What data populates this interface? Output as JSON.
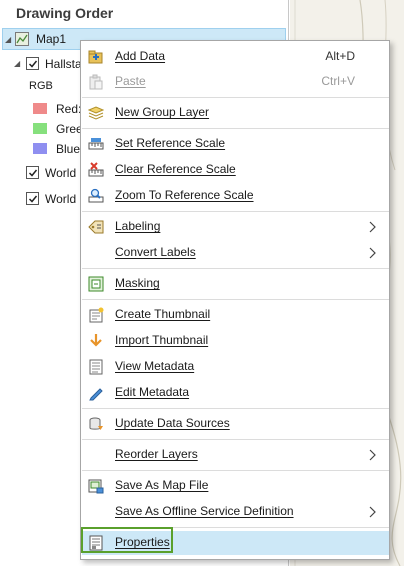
{
  "panel": {
    "title": "Drawing Order",
    "map_label": "Map1",
    "layer_label": "Hallsta",
    "rgb_label": "RGB",
    "bands": [
      {
        "label": "Red:",
        "color": "#ef8a8a"
      },
      {
        "label": "Gree",
        "color": "#86e07d"
      },
      {
        "label": "Blue",
        "color": "#8f8ff0"
      }
    ],
    "world1_label": "World",
    "world2_label": "World"
  },
  "menu": {
    "items": [
      {
        "key": "add-data",
        "label": "Add Data",
        "shortcut": "Alt+D",
        "icon": "add-data-icon"
      },
      {
        "key": "paste",
        "label": "Paste",
        "shortcut": "Ctrl+V",
        "icon": "paste-icon",
        "disabled": true
      },
      {
        "key": "new-group-layer",
        "label": "New Group Layer",
        "icon": "group-layer-icon"
      },
      {
        "key": "set-reference-scale",
        "label": "Set Reference Scale",
        "icon": "set-scale-icon"
      },
      {
        "key": "clear-reference-scale",
        "label": "Clear Reference Scale",
        "icon": "clear-scale-icon"
      },
      {
        "key": "zoom-to-reference-scale",
        "label": "Zoom To Reference Scale",
        "icon": "zoom-scale-icon"
      },
      {
        "key": "labeling",
        "label": "Labeling",
        "icon": "labeling-icon",
        "submenu": true
      },
      {
        "key": "convert-labels",
        "label": "Convert Labels",
        "submenu": true
      },
      {
        "key": "masking",
        "label": "Masking",
        "icon": "masking-icon"
      },
      {
        "key": "create-thumbnail",
        "label": "Create Thumbnail",
        "icon": "create-thumbnail-icon"
      },
      {
        "key": "import-thumbnail",
        "label": "Import Thumbnail",
        "icon": "import-thumbnail-icon"
      },
      {
        "key": "view-metadata",
        "label": "View Metadata",
        "icon": "view-metadata-icon"
      },
      {
        "key": "edit-metadata",
        "label": "Edit Metadata",
        "icon": "edit-metadata-icon"
      },
      {
        "key": "update-data-sources",
        "label": "Update Data Sources",
        "icon": "update-sources-icon"
      },
      {
        "key": "reorder-layers",
        "label": "Reorder Layers",
        "submenu": true
      },
      {
        "key": "save-as-map-file",
        "label": "Save As Map File",
        "icon": "save-map-file-icon"
      },
      {
        "key": "save-as-offline",
        "label": "Save As Offline Service Definition",
        "submenu": true
      },
      {
        "key": "properties",
        "label": "Properties",
        "icon": "properties-icon",
        "highlighted": true
      }
    ]
  },
  "colors": {
    "selection": "#cde8f7",
    "highlight_border": "#5aa02c",
    "disabled_text": "#9a9a9a"
  }
}
